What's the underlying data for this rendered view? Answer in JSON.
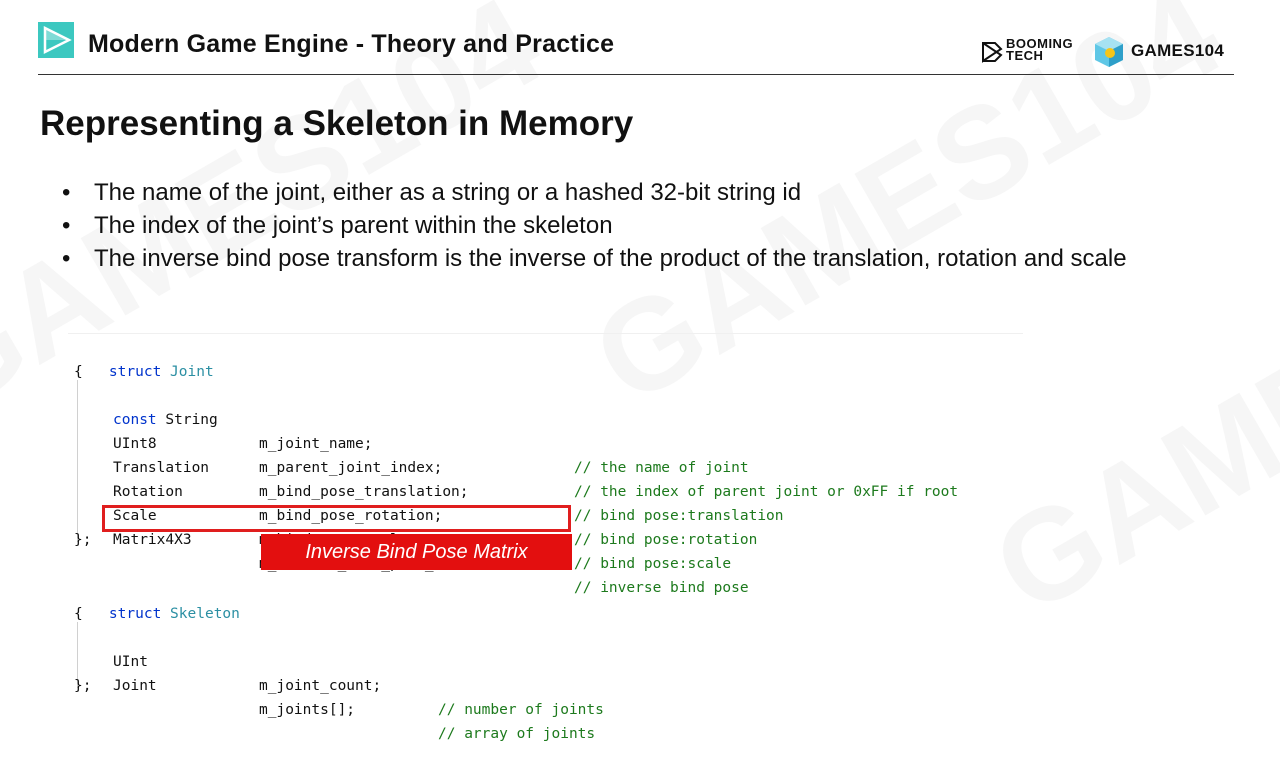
{
  "header": {
    "course_title": "Modern Game Engine - Theory and Practice",
    "booming_line1": "BOOMING",
    "booming_line2": "TECH",
    "games_label": "GAMES104"
  },
  "slide": {
    "title": "Representing a Skeleton in Memory",
    "bullets": [
      "The name of the joint, either as a string or a hashed 32-bit string id",
      "The index of the joint’s parent within the skeleton",
      "The inverse bind pose transform is the inverse of the product of the translation, rotation and scale"
    ],
    "bullet_symbol": "•"
  },
  "code": {
    "joint_struct_kw": "struct",
    "joint_struct_name": "Joint",
    "open_brace": "{",
    "close_brace": "};",
    "joint_fields": [
      {
        "type_kw": "const",
        "type": "String",
        "name": "m_joint_name;",
        "comment": "// the name of joint"
      },
      {
        "type_kw": "",
        "type": "UInt8",
        "name": "m_parent_joint_index;",
        "comment": "// the index of parent joint or 0xFF if root"
      },
      {
        "type_kw": "",
        "type": "Translation",
        "name": "m_bind_pose_translation;",
        "comment": "// bind pose:translation"
      },
      {
        "type_kw": "",
        "type": "Rotation",
        "name": "m_bind_pose_rotation;",
        "comment": "// bind pose:rotation"
      },
      {
        "type_kw": "",
        "type": "Scale",
        "name": "m_bind_pose_scale;",
        "comment": "// bind pose:scale"
      },
      {
        "type_kw": "",
        "type": "Matrix4X3",
        "name": "m_inverse_bind_pose_transform;",
        "comment": "// inverse bind pose"
      }
    ],
    "skeleton_struct_kw": "struct",
    "skeleton_struct_name": "Skeleton",
    "skeleton_fields": [
      {
        "type": "UInt",
        "name": "m_joint_count;",
        "comment": "// number of joints"
      },
      {
        "type": "Joint",
        "name": "m_joints[];",
        "comment": "// array of joints"
      }
    ]
  },
  "callout": {
    "label": "Inverse Bind Pose Matrix",
    "color": "#e30f0f"
  },
  "colors": {
    "keyword": "#0033cc",
    "type_name": "#2b8fa3",
    "comment": "#1d7a1d",
    "logo_teal": "#3cc8c0"
  }
}
